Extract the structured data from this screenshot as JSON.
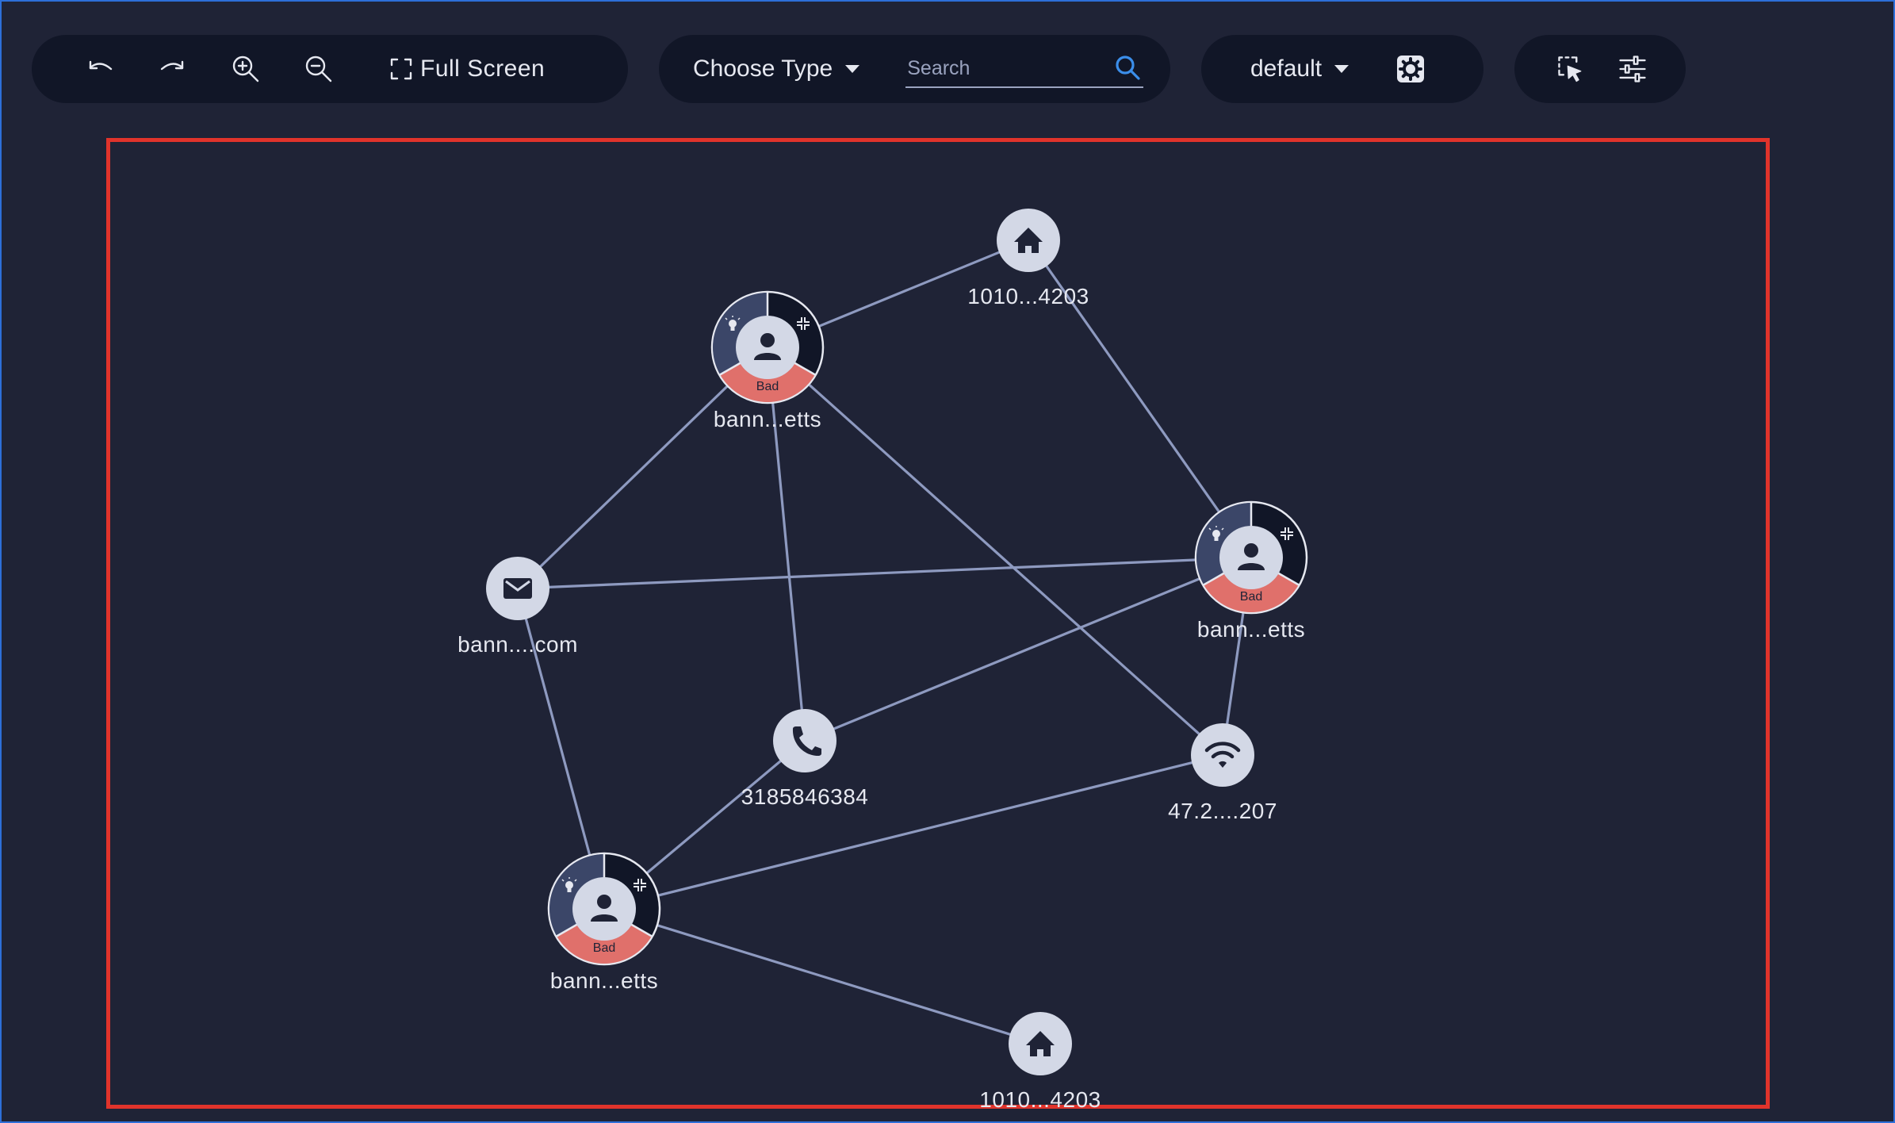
{
  "toolbar": {
    "undo_icon": "undo-icon",
    "redo_icon": "redo-icon",
    "zoom_in_icon": "zoom-in-icon",
    "zoom_out_icon": "zoom-out-icon",
    "full_screen_label": "Full Screen",
    "type_dropdown_label": "Choose Type",
    "search_placeholder": "Search",
    "layout_dropdown_label": "default",
    "settings_icon": "gear-icon",
    "select_icon": "selection-cursor-icon",
    "filter_icon": "sliders-icon"
  },
  "colors": {
    "background": "#1f2336",
    "toolbar": "#111627",
    "node": "#d3d8e6",
    "badge_bad": "#e0706b",
    "ring_dark": "#3b4668",
    "edge": "#8e9ac0",
    "selection_border": "#e0332b",
    "search_accent": "#3b8eea"
  },
  "graph": {
    "nodes": [
      {
        "id": "person-1",
        "type": "person",
        "label": "bann...etts",
        "badge": "Bad"
      },
      {
        "id": "person-2",
        "type": "person",
        "label": "bann...etts",
        "badge": "Bad"
      },
      {
        "id": "person-3",
        "type": "person",
        "label": "bann...etts",
        "badge": "Bad"
      },
      {
        "id": "address-1",
        "type": "address",
        "label": "1010...4203"
      },
      {
        "id": "address-2",
        "type": "address",
        "label": "1010...4203"
      },
      {
        "id": "email-1",
        "type": "email",
        "label": "bann....com"
      },
      {
        "id": "phone-1",
        "type": "phone",
        "label": "3185846384"
      },
      {
        "id": "ip-1",
        "type": "ip",
        "label": "47.2....207"
      }
    ],
    "edges": [
      [
        "person-1",
        "address-1"
      ],
      [
        "person-1",
        "email-1"
      ],
      [
        "person-1",
        "phone-1"
      ],
      [
        "person-1",
        "ip-1"
      ],
      [
        "email-1",
        "person-2"
      ],
      [
        "email-1",
        "person-3"
      ],
      [
        "person-2",
        "phone-1"
      ],
      [
        "person-2",
        "ip-1"
      ],
      [
        "person-2",
        "address-2"
      ],
      [
        "person-3",
        "address-1"
      ],
      [
        "person-3",
        "phone-1"
      ],
      [
        "person-3",
        "ip-1"
      ]
    ]
  }
}
